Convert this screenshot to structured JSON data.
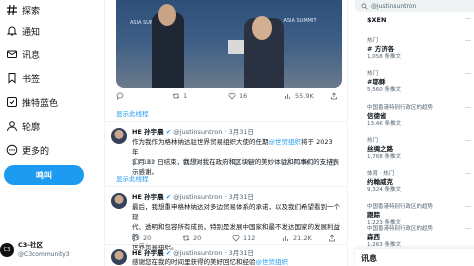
{
  "nav": {
    "explore": "探索",
    "notifications": "通知",
    "messages": "讯息",
    "bookmarks": "书签",
    "blue": "推特蓝色",
    "profile": "轮廓",
    "more": "更多的",
    "post_button": "鸣叫"
  },
  "account": {
    "name": "C3-社区",
    "handle": "@C3community3"
  },
  "media": {
    "banner_left": "ASIA SUMMIT",
    "banner_right": "ASIA SUMMIT"
  },
  "tweet0": {
    "replies": "",
    "retweets": "1",
    "likes": "16",
    "views": "55.9K",
    "show_thread": "显示此线程"
  },
  "tweet1": {
    "name": "HE 孙宇晨",
    "handle": "@justinsuntron",
    "date": "3月31日",
    "text_a": "作为我作为格林纳达驻世界贸易组织大使的任期",
    "link": "@世贸组织",
    "text_b": "将于 2023 年",
    "line2": "3 月 31 日结束，我想对我在政府和区块链的美妙体验和同事们的支持表示感谢。",
    "replies": "162",
    "retweets": "73",
    "likes": "157",
    "views": "41.6K",
    "show_thread": "显示此线程"
  },
  "tweet2": {
    "name": "HE 孙宇晨",
    "handle": "@justinsuntron",
    "date": "3月31日",
    "line1": "最后，我想重申格林纳达对多边贸易体系的承诺，以及我们希望看到一个现",
    "line2": "代、透明和包容所有成员，特别是发展中国家和最不发达国家的发展利益的",
    "line3": "世界贸易组织。",
    "replies": "20",
    "retweets": "20",
    "likes": "112",
    "views": "21.2K"
  },
  "tweet3": {
    "name": "HE 孙宇晨",
    "handle": "@justinsuntron",
    "date": "3月31日",
    "line1": "感谢您在我的时间里获得的美好回忆和经验",
    "link": "@世贸组织"
  },
  "right": {
    "pill_text": "@justinsuntron",
    "trends": [
      {
        "cat": "",
        "title": "$XEN",
        "count": ""
      },
      {
        "cat": "热门",
        "title": "# 方济各",
        "count": "1,058 条推文"
      },
      {
        "cat": "热门",
        "title": "#耶稣",
        "count": "5,560 条推文"
      },
      {
        "cat": "中国香港特别行政区的趋势",
        "title": "信德省",
        "count": "13.4K 条推文"
      },
      {
        "cat": "热门",
        "title": "丝绸之路",
        "count": "1,768 条推文"
      },
      {
        "cat": "体育 · 热门",
        "title": "约翰威克",
        "count": "9,324 条推文"
      },
      {
        "cat": "中国香港特别行政区的趋势",
        "title": "跟踪",
        "count": "1,223 条推文"
      },
      {
        "cat": "中国香港特别行政区的趋势",
        "title": "森西",
        "count": "1,263 条推文"
      }
    ]
  },
  "messages_bar": "讯息"
}
